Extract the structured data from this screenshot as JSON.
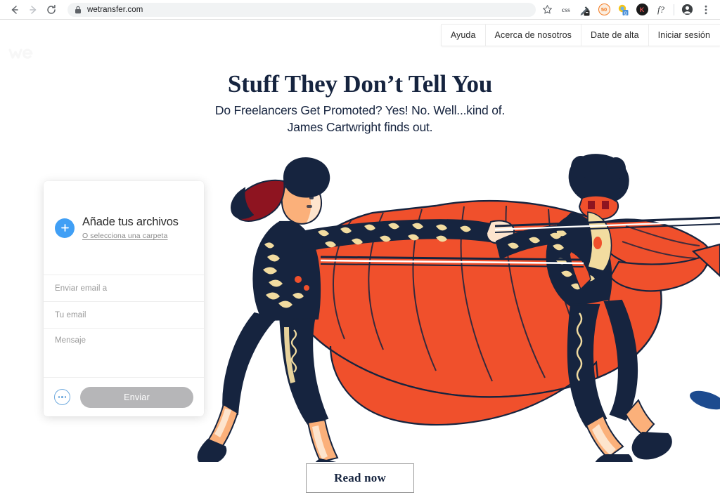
{
  "browser": {
    "url": "wetransfer.com",
    "back_icon": "back-arrow-icon",
    "forward_icon": "forward-arrow-icon",
    "reload_icon": "reload-icon",
    "lock_icon": "lock-icon",
    "bookmark_icon": "star-icon",
    "extensions": [
      {
        "name": "css-extension",
        "label": "css"
      },
      {
        "name": "eyedropper-extension",
        "label": ""
      },
      {
        "name": "seo-extension",
        "label": "50"
      },
      {
        "name": "grammar-extension",
        "label": "g"
      },
      {
        "name": "kaspersky-extension",
        "label": "K"
      },
      {
        "name": "fonts-extension",
        "label": "f?"
      }
    ],
    "profile_icon": "profile-avatar-icon",
    "menu_icon": "kebab-menu-icon"
  },
  "site": {
    "logo_label": "we",
    "nav": [
      {
        "label": "Ayuda",
        "name": "nav-item-ayuda"
      },
      {
        "label": "Acerca de nosotros",
        "name": "nav-item-acerca-de-nosotros"
      },
      {
        "label": "Date de alta",
        "name": "nav-item-date-de-alta"
      },
      {
        "label": "Iniciar sesión",
        "name": "nav-item-iniciar-sesion"
      }
    ]
  },
  "hero": {
    "headline": "Stuff They Don’t Tell You",
    "subhead_line1": "Do Freelancers Get Promoted? Yes! No. Well...kind of.",
    "subhead_line2": "James Cartwright finds out.",
    "cta_label": "Read now"
  },
  "upload_card": {
    "add_files_title": "Añade tus archivos",
    "select_folder_link": "O selecciona una carpeta",
    "plus_icon": "plus-icon",
    "fields": [
      {
        "placeholder": "Enviar email a",
        "name": "recipient-email-input"
      },
      {
        "placeholder": "Tu email",
        "name": "sender-email-input"
      },
      {
        "placeholder": "Mensaje",
        "name": "message-input"
      }
    ],
    "more_options_icon": "more-options-icon",
    "send_label": "Enviar"
  },
  "colors": {
    "navy": "#16243f",
    "orange": "#f0502c",
    "accent_blue": "#409ff5",
    "disabled_gray": "#b6b6b8",
    "skin": "#fbb07a",
    "gold": "#f2dca0",
    "dark_red": "#8e1420"
  }
}
